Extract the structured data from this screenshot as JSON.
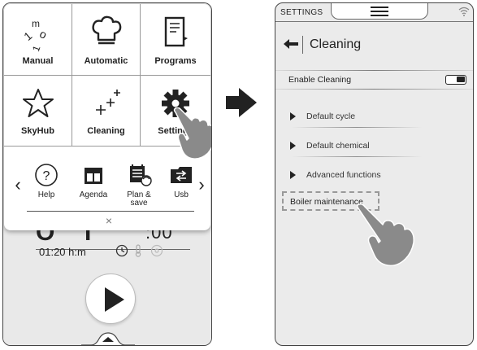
{
  "left_screen": {
    "tiles": [
      {
        "label": "Manual",
        "icon": "manual-icon"
      },
      {
        "label": "Automatic",
        "icon": "chef-hat-icon"
      },
      {
        "label": "Programs",
        "icon": "book-icon"
      },
      {
        "label": "SkyHub",
        "icon": "star-icon"
      },
      {
        "label": "Cleaning",
        "icon": "sparkles-icon"
      },
      {
        "label": "Settings",
        "icon": "gear-icon"
      }
    ],
    "shortcuts": [
      {
        "label": "Help",
        "icon": "help-icon"
      },
      {
        "label": "Agenda",
        "icon": "agenda-icon"
      },
      {
        "label": "Plan & save",
        "icon": "plan-save-icon"
      },
      {
        "label": "Usb",
        "icon": "usb-icon"
      }
    ],
    "prev_arrow": "‹",
    "next_arrow": "›",
    "close_glyph": "×",
    "big_time_suffix": ":00",
    "duration": "01:20 h:m"
  },
  "right_screen": {
    "status_title": "SETTINGS",
    "page_title": "Cleaning",
    "enable_label": "Enable Cleaning",
    "enable_on": true,
    "menu_items": [
      {
        "label": "Default cycle"
      },
      {
        "label": "Default chemical"
      },
      {
        "label": "Advanced functions"
      }
    ],
    "highlighted_item": "Boiler maintenance"
  },
  "colors": {
    "hand": "#8a8a8a",
    "panel_bg": "#ebebeb",
    "text": "#222222"
  }
}
